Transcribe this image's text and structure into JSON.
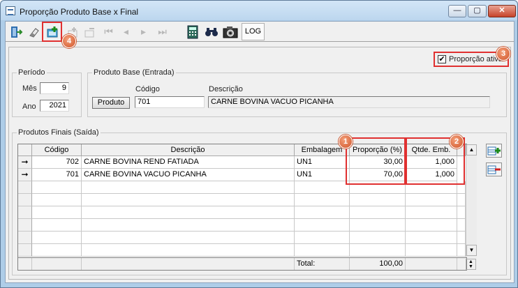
{
  "window": {
    "title": "Proporção Produto Base x Final",
    "controls": {
      "minimize": "—",
      "maximize": "▢",
      "close": "✕"
    }
  },
  "toolbar": {
    "log_label": "LOG",
    "buttons": [
      "exit-icon",
      "eraser-icon",
      "add-icon",
      "edit-disabled-icon",
      "delete-disabled-icon",
      "first-disabled",
      "prev-disabled",
      "next-disabled",
      "last-disabled",
      "calculator-icon",
      "binoculars-icon",
      "camera-icon"
    ]
  },
  "annotations": {
    "b1": "1",
    "b2": "2",
    "b3": "3",
    "b4": "4"
  },
  "proportion_active": {
    "label": "Proporção ativa",
    "checked": "✔"
  },
  "periodo": {
    "group_label": "Período",
    "mes_label": "Mês",
    "mes_value": "9",
    "ano_label": "Ano",
    "ano_value": "2021"
  },
  "produto_base": {
    "group_label": "Produto Base (Entrada)",
    "codigo_label": "Código",
    "descricao_label": "Descrição",
    "button_label": "Produto",
    "codigo_value": "701",
    "descricao_value": "CARNE BOVINA VACUO PICANHA"
  },
  "produtos_finais": {
    "group_label": "Produtos Finais (Saída)",
    "columns": {
      "codigo": "Código",
      "descricao": "Descrição",
      "embalagem": "Embalagem",
      "proporcao": "Proporção (%)",
      "qtde": "Qtde. Emb."
    },
    "rows": [
      {
        "indicator": "➞",
        "codigo": "702",
        "descricao": "CARNE BOVINA REND FATIADA",
        "embalagem": "UN1",
        "proporcao": "30,00",
        "qtde": "1,000"
      },
      {
        "indicator": "➞",
        "codigo": "701",
        "descricao": "CARNE BOVINA VACUO PICANHA",
        "embalagem": "UN1",
        "proporcao": "70,00",
        "qtde": "1,000"
      }
    ],
    "total_label": "Total:",
    "total_value": "100,00"
  },
  "colors": {
    "accent_red": "#e03030",
    "badge": "#d0552a",
    "titlebar": "#bcd6ee"
  }
}
